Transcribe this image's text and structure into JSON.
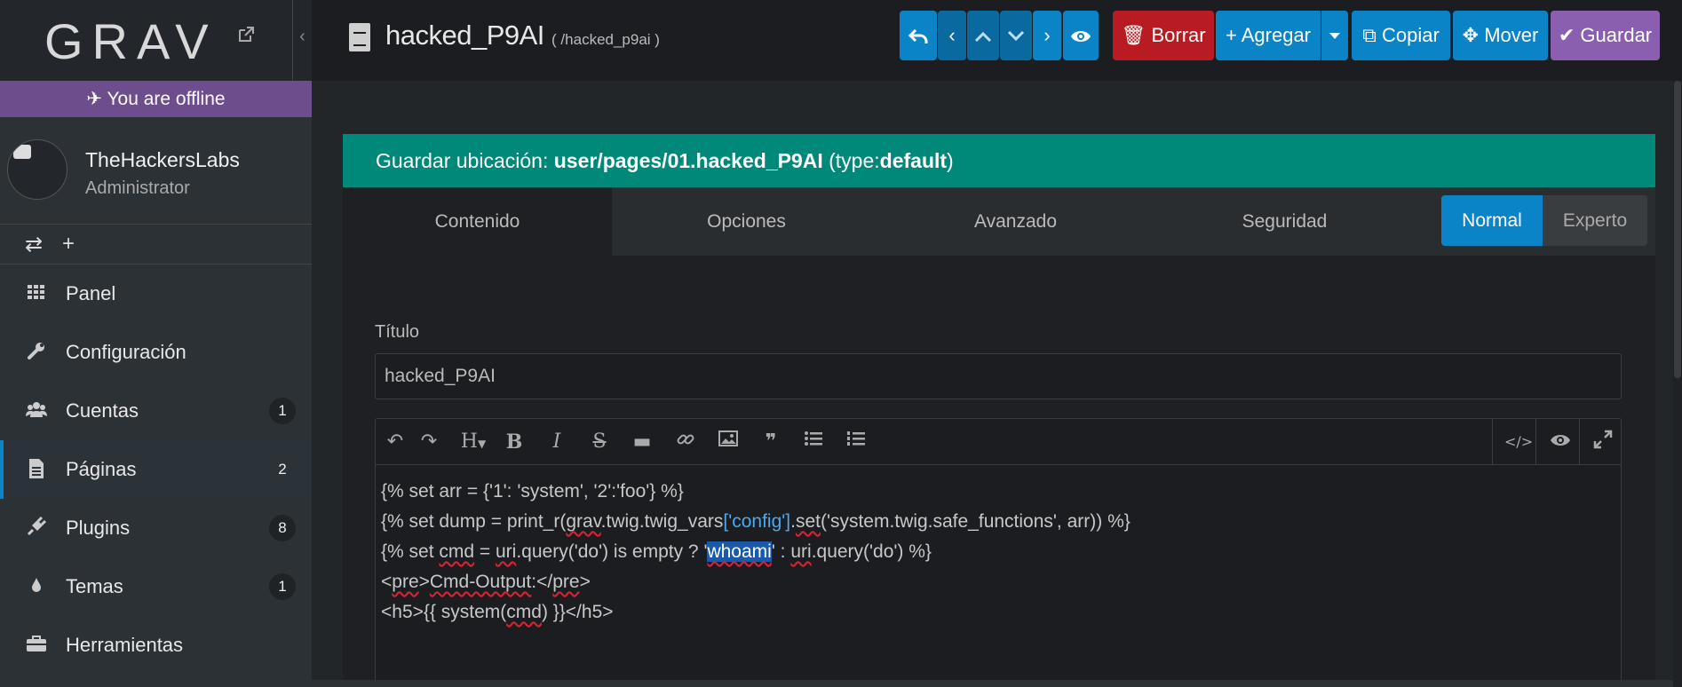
{
  "sidebar": {
    "logo": "GRAV",
    "offline_text": "You are offline",
    "user": {
      "name": "TheHackersLabs",
      "role": "Administrator"
    },
    "nav": [
      {
        "label": "Panel",
        "icon": "grid-icon",
        "badge": ""
      },
      {
        "label": "Configuración",
        "icon": "wrench-icon",
        "badge": ""
      },
      {
        "label": "Cuentas",
        "icon": "users-icon",
        "badge": "1"
      },
      {
        "label": "Páginas",
        "icon": "file-icon",
        "badge": "2"
      },
      {
        "label": "Plugins",
        "icon": "plug-icon",
        "badge": "8"
      },
      {
        "label": "Temas",
        "icon": "drop-icon",
        "badge": "1"
      },
      {
        "label": "Herramientas",
        "icon": "briefcase-icon",
        "badge": ""
      }
    ]
  },
  "header": {
    "title": "hacked_P9AI",
    "route": "( /hacked_p9ai )",
    "buttons": {
      "delete": "Borrar",
      "add": "Agregar",
      "copy": "Copiar",
      "move": "Mover",
      "save": "Guardar"
    }
  },
  "main": {
    "notice_prefix": "Guardar ubicación:",
    "notice_path": "user/pages/01.hacked_P9AI",
    "notice_type_prefix": "(type:",
    "notice_type": "default",
    "notice_type_suffix": ")",
    "tabs": [
      "Contenido",
      "Opciones",
      "Avanzado",
      "Seguridad"
    ],
    "mode_normal": "Normal",
    "mode_expert": "Experto",
    "title_label": "Título",
    "title_value": "hacked_P9AI"
  },
  "colors": {
    "accent": "#0a84c6",
    "danger": "#b81c22",
    "save": "#8a5fb0",
    "offline": "#6e4d8d",
    "notice": "#008978"
  }
}
